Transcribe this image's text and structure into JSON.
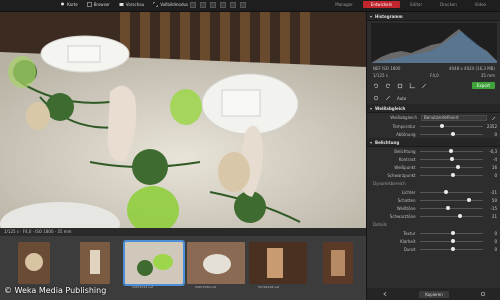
{
  "topbar": {
    "items": [
      {
        "icon": "map-pin-icon",
        "label": "Karte"
      },
      {
        "icon": "browser-icon",
        "label": "Browser"
      },
      {
        "icon": "preview-icon",
        "label": "Vorschau"
      },
      {
        "icon": "fullscreen-icon",
        "label": "Vollbildmodus"
      }
    ],
    "modes": [
      "Manager",
      "Entwickeln",
      "Editor",
      "Drucken",
      "Video"
    ],
    "active_mode": "Entwickeln"
  },
  "status_bar": "1/125 s · F4,0 · ISO 1800 · 35 mm",
  "filmstrip": {
    "thumbs": [
      {
        "label": ""
      },
      {
        "label": ""
      },
      {
        "label": "50674122.nef"
      },
      {
        "label": "50677056.nef"
      },
      {
        "label": "50704128.nef"
      },
      {
        "label": ""
      }
    ]
  },
  "watermark": "© Weka Media Publishing",
  "panel": {
    "histogram_title": "Histogramm",
    "camera_info": {
      "left": "NEF  ISO 1800",
      "right": "4048 x 4024 (16,3 MB)"
    },
    "exposure_info": {
      "left": "1/125 s",
      "mid": "F4,0",
      "right": "35 mm"
    },
    "export_label": "Export",
    "auto_label": "Auto",
    "wb": {
      "title": "Weißabgleich",
      "preset_label": "Weißabgleich",
      "preset_value": "Benutzerdefiniert",
      "rows": [
        {
          "label": "Temperatur",
          "value": "2352"
        },
        {
          "label": "Abtönung",
          "value": "0"
        }
      ]
    },
    "exposure": {
      "title": "Belichtung",
      "rows": [
        {
          "label": "Belichtung",
          "value": "-0,3"
        },
        {
          "label": "Kontrast",
          "value": "-4"
        },
        {
          "label": "Weißpunkt",
          "value": "16"
        },
        {
          "label": "Schwarzpunkt",
          "value": "0"
        }
      ],
      "dynamic_label": "Dynamikbereich",
      "dynamic_rows": [
        {
          "label": "Lichter",
          "value": "-21"
        },
        {
          "label": "Schatten",
          "value": "50"
        },
        {
          "label": "Weißtöne",
          "value": "-15"
        },
        {
          "label": "Schwarztöne",
          "value": "21"
        }
      ],
      "details_label": "Details",
      "detail_rows": [
        {
          "label": "Textur",
          "value": "0"
        },
        {
          "label": "Klarheit",
          "value": "0"
        },
        {
          "label": "Dunst",
          "value": "0"
        }
      ]
    },
    "bottom_buttons": {
      "copy": "Kopieren"
    }
  },
  "colors": {
    "accent": "#c0262c",
    "export": "#3fa33a",
    "selected": "#4a8fd8"
  }
}
